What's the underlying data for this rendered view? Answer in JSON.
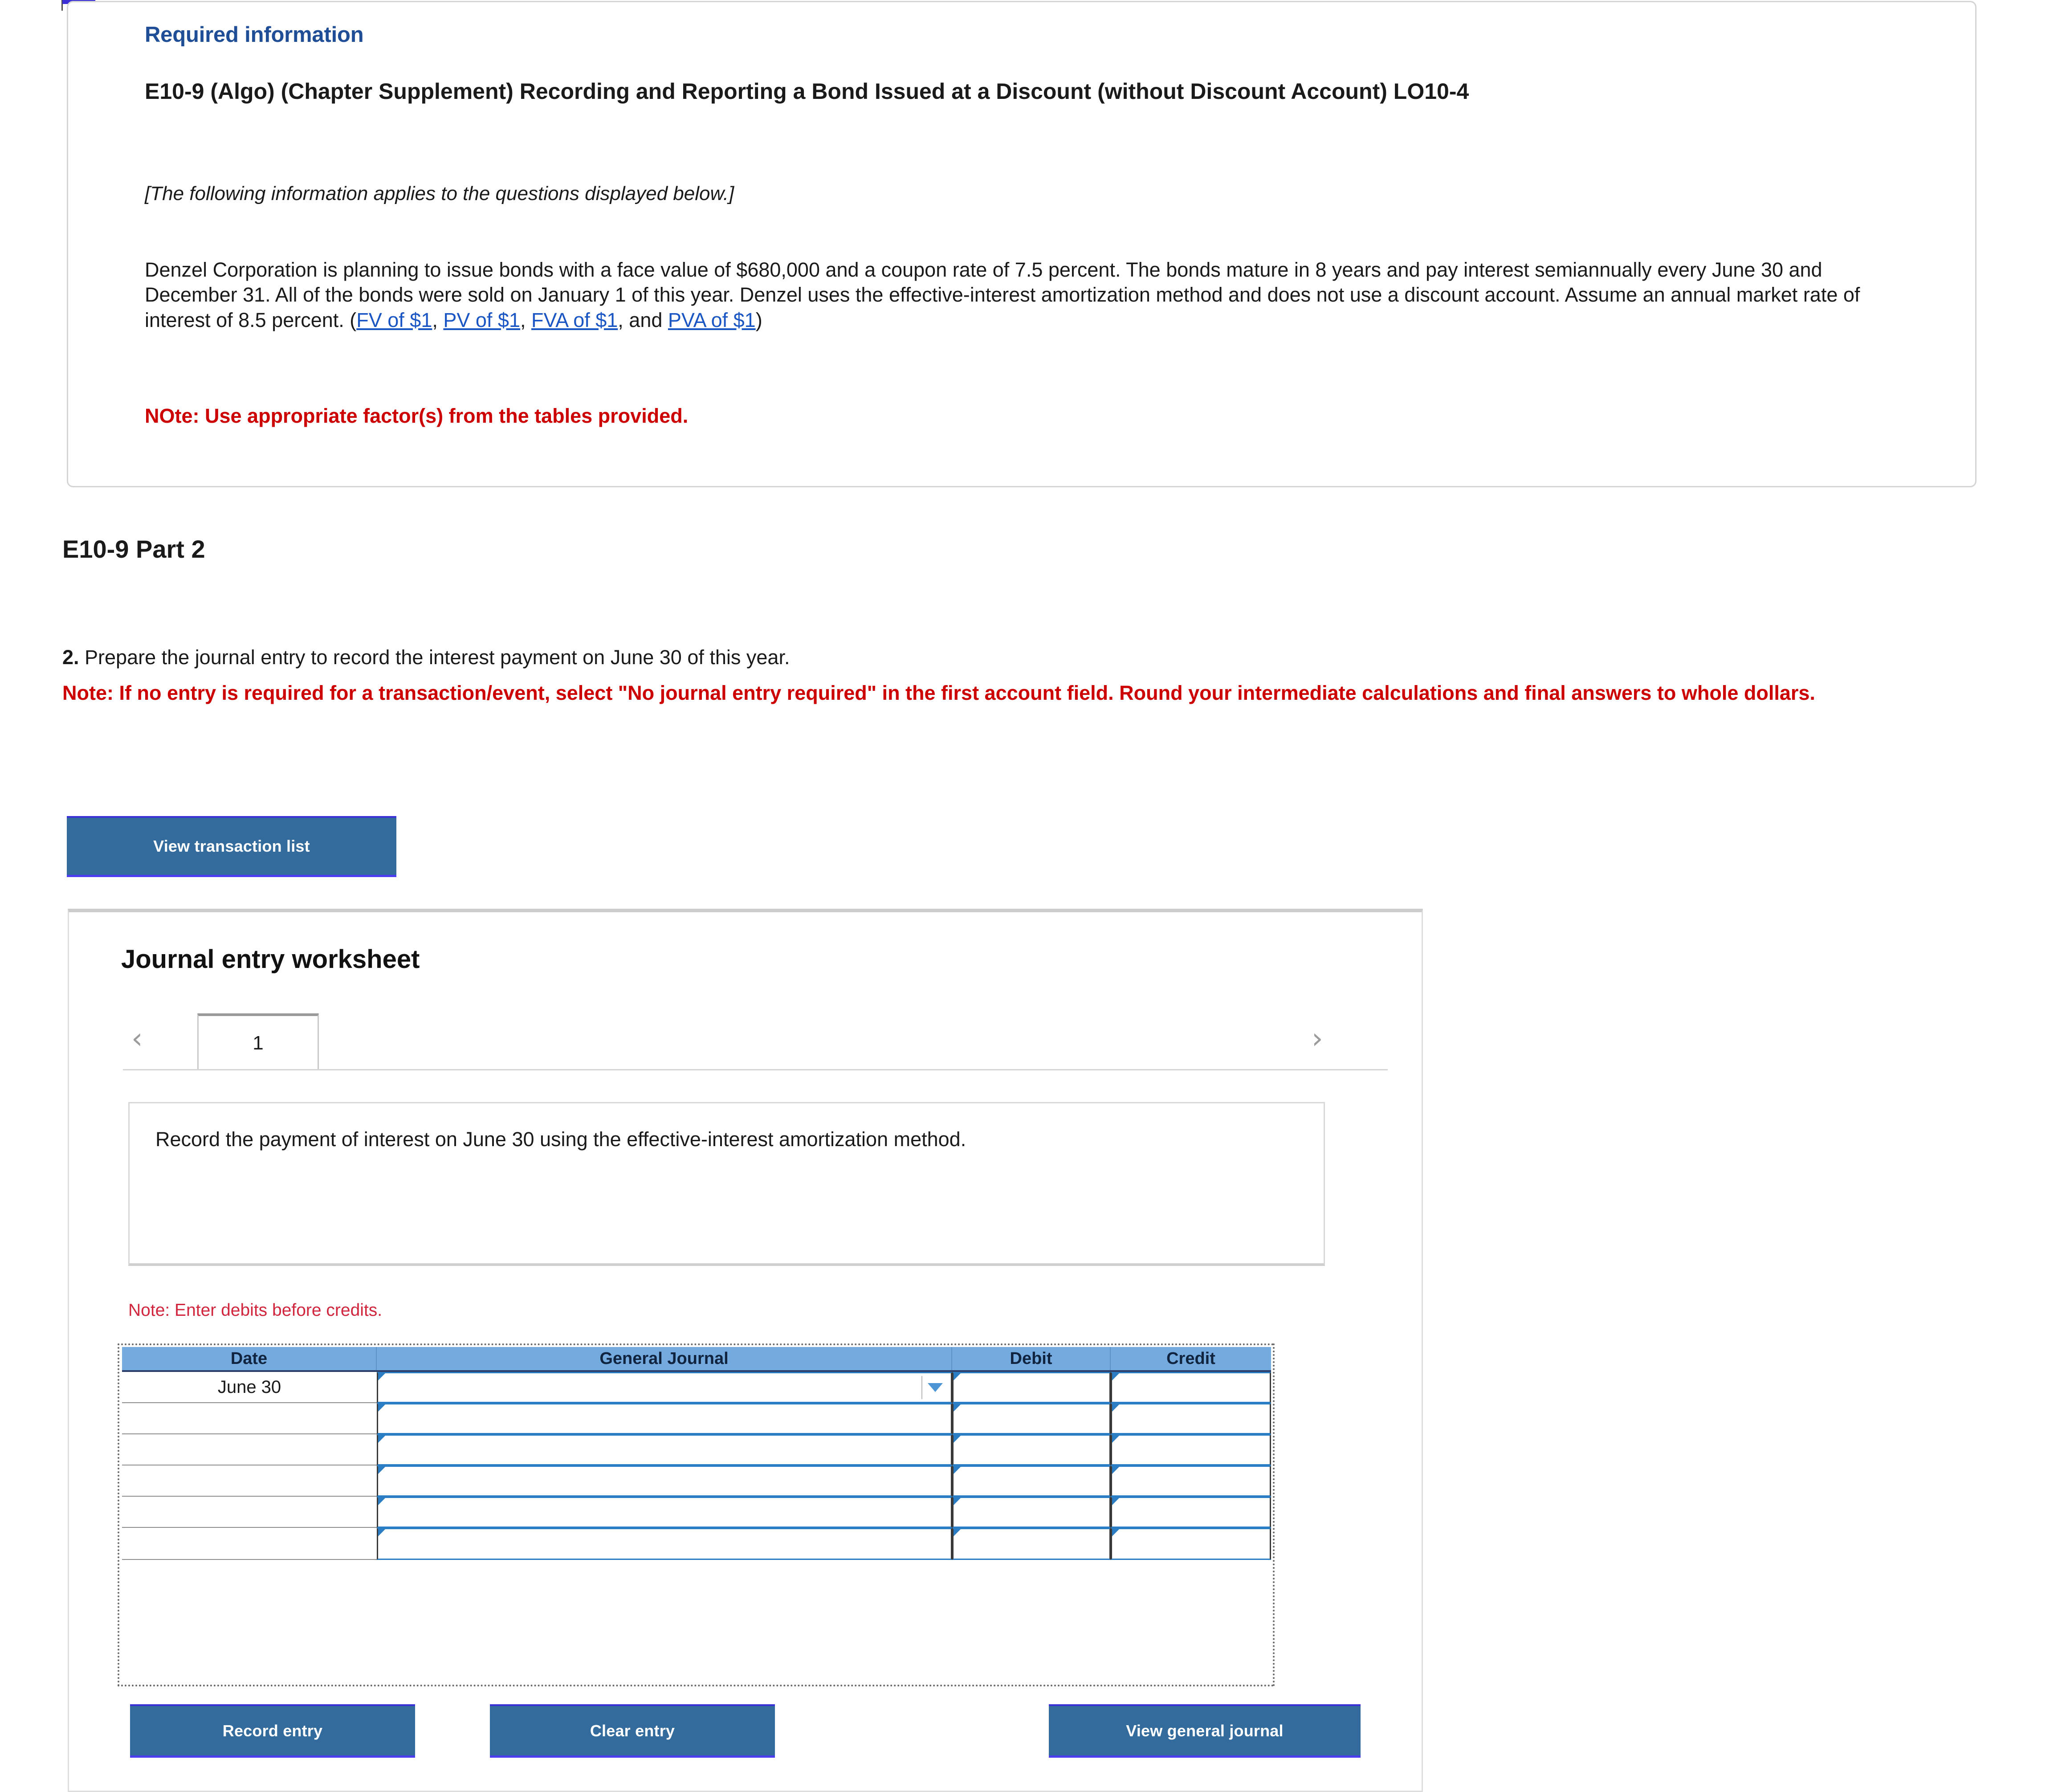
{
  "required_info": {
    "label": "Required information",
    "exercise_title": "E10-9 (Algo) (Chapter Supplement) Recording and Reporting a Bond Issued at a Discount (without Discount Account) LO10-4",
    "applies_note": "[The following information applies to the questions displayed below.]",
    "paragraph_part1": "Denzel Corporation is planning to issue bonds with a face value of $680,000 and a coupon rate of 7.5 percent. The bonds mature in 8 years and pay interest semiannually every June 30 and December 31. All of the bonds were sold on January 1 of this year. Denzel uses the effective-interest amortization method and does not use a discount account. Assume an annual market rate of interest of 8.5 percent. (",
    "link_fv": "FV of $1",
    "sep1": ", ",
    "link_pv": "PV of $1",
    "sep2": ", ",
    "link_fva": "FVA of $1",
    "sep3": ", and ",
    "link_pva": "PVA of $1",
    "paragraph_end": ")",
    "tables_note": "NOte: Use appropriate factor(s) from the tables provided."
  },
  "part": {
    "heading": "E10-9 Part 2",
    "question_number": "2.",
    "question_text": " Prepare the journal entry to record the interest payment on June 30 of this year.",
    "red_note": "Note: If no entry is required for a transaction/event, select \"No journal entry required\" in the first account field. Round your intermediate calculations and final answers to whole dollars."
  },
  "toolbar": {
    "view_transaction_list": "View transaction list"
  },
  "worksheet": {
    "title": "Journal entry worksheet",
    "prev_icon": "‹",
    "next_icon": "›",
    "tabs": [
      {
        "label": "1"
      }
    ],
    "description": "Record the payment of interest on June 30 using the effective-interest amortization method.",
    "debit_note": "Note: Enter debits before credits.",
    "table": {
      "columns": [
        "Date",
        "General Journal",
        "Debit",
        "Credit"
      ],
      "rows": [
        {
          "date": "June 30",
          "general_journal": "",
          "debit": "",
          "credit": "",
          "has_dropdown": true
        },
        {
          "date": "",
          "general_journal": "",
          "debit": "",
          "credit": "",
          "has_dropdown": false
        },
        {
          "date": "",
          "general_journal": "",
          "debit": "",
          "credit": "",
          "has_dropdown": false
        },
        {
          "date": "",
          "general_journal": "",
          "debit": "",
          "credit": "",
          "has_dropdown": false
        },
        {
          "date": "",
          "general_journal": "",
          "debit": "",
          "credit": "",
          "has_dropdown": false
        },
        {
          "date": "",
          "general_journal": "",
          "debit": "",
          "credit": "",
          "has_dropdown": false
        }
      ]
    },
    "actions": {
      "record_entry": "Record entry",
      "clear_entry": "Clear entry",
      "view_general_journal": "View general journal"
    }
  },
  "colors": {
    "button_blue": "#336b9c",
    "table_header_blue": "#74aade",
    "link_blue": "#1a55c4",
    "heading_blue": "#1f4e96",
    "alert_red": "#cc0000",
    "note_red": "#d0253d"
  }
}
